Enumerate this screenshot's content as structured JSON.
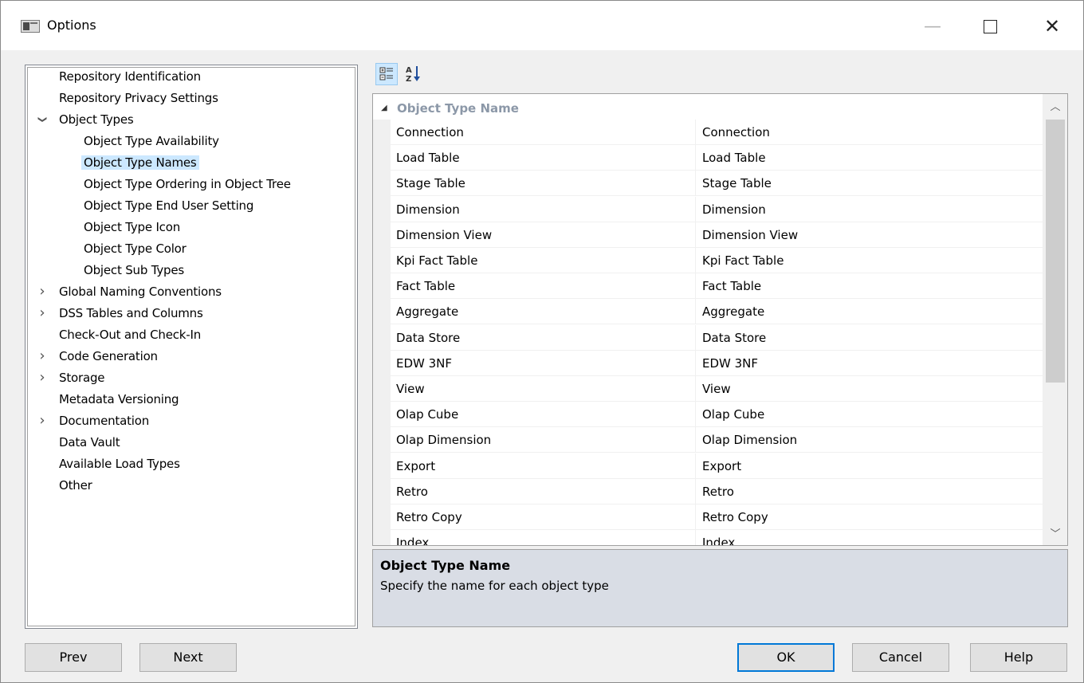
{
  "window": {
    "title": "Options"
  },
  "title_buttons": {
    "minimize": "—",
    "close": "✕"
  },
  "toolbar": {
    "categorized_icon": "categorized-icon",
    "alphabetical_icon": "sort-az-icon"
  },
  "tree": {
    "items": [
      {
        "label": "Repository Identification",
        "level": 0,
        "expander": "",
        "selected": false
      },
      {
        "label": "Repository Privacy Settings",
        "level": 0,
        "expander": "",
        "selected": false
      },
      {
        "label": "Object Types",
        "level": 0,
        "expander": "expanded",
        "selected": false
      },
      {
        "label": "Object Type Availability",
        "level": 1,
        "expander": "",
        "selected": false
      },
      {
        "label": "Object Type Names",
        "level": 1,
        "expander": "",
        "selected": true
      },
      {
        "label": "Object Type Ordering in Object Tree",
        "level": 1,
        "expander": "",
        "selected": false
      },
      {
        "label": "Object Type End User Setting",
        "level": 1,
        "expander": "",
        "selected": false
      },
      {
        "label": "Object Type Icon",
        "level": 1,
        "expander": "",
        "selected": false
      },
      {
        "label": "Object Type Color",
        "level": 1,
        "expander": "",
        "selected": false
      },
      {
        "label": "Object Sub Types",
        "level": 1,
        "expander": "",
        "selected": false
      },
      {
        "label": "Global Naming Conventions",
        "level": 0,
        "expander": "collapsed",
        "selected": false
      },
      {
        "label": "DSS Tables and Columns",
        "level": 0,
        "expander": "collapsed",
        "selected": false
      },
      {
        "label": "Check-Out and Check-In",
        "level": 0,
        "expander": "",
        "selected": false
      },
      {
        "label": "Code Generation",
        "level": 0,
        "expander": "collapsed",
        "selected": false
      },
      {
        "label": "Storage",
        "level": 0,
        "expander": "collapsed",
        "selected": false
      },
      {
        "label": "Metadata Versioning",
        "level": 0,
        "expander": "",
        "selected": false
      },
      {
        "label": "Documentation",
        "level": 0,
        "expander": "collapsed",
        "selected": false
      },
      {
        "label": "Data Vault",
        "level": 0,
        "expander": "",
        "selected": false
      },
      {
        "label": "Available Load Types",
        "level": 0,
        "expander": "",
        "selected": false
      },
      {
        "label": "Other",
        "level": 0,
        "expander": "",
        "selected": false
      }
    ]
  },
  "grid": {
    "category": "Object Type Name",
    "rows": [
      {
        "name": "Connection",
        "value": "Connection"
      },
      {
        "name": "Load Table",
        "value": "Load Table"
      },
      {
        "name": "Stage Table",
        "value": "Stage Table"
      },
      {
        "name": "Dimension",
        "value": "Dimension"
      },
      {
        "name": "Dimension View",
        "value": "Dimension View"
      },
      {
        "name": "Kpi Fact Table",
        "value": "Kpi Fact Table"
      },
      {
        "name": "Fact Table",
        "value": "Fact Table"
      },
      {
        "name": "Aggregate",
        "value": "Aggregate"
      },
      {
        "name": "Data Store",
        "value": "Data Store"
      },
      {
        "name": "EDW 3NF",
        "value": "EDW 3NF"
      },
      {
        "name": "View",
        "value": "View"
      },
      {
        "name": "Olap Cube",
        "value": "Olap Cube"
      },
      {
        "name": "Olap Dimension",
        "value": "Olap Dimension"
      },
      {
        "name": "Export",
        "value": "Export"
      },
      {
        "name": "Retro",
        "value": "Retro"
      },
      {
        "name": "Retro Copy",
        "value": "Retro Copy"
      },
      {
        "name": "Index",
        "value": "Index"
      }
    ]
  },
  "description": {
    "title": "Object Type Name",
    "text": "Specify the name for each object type"
  },
  "buttons": {
    "prev": "Prev",
    "next": "Next",
    "ok": "OK",
    "cancel": "Cancel",
    "help": "Help"
  }
}
